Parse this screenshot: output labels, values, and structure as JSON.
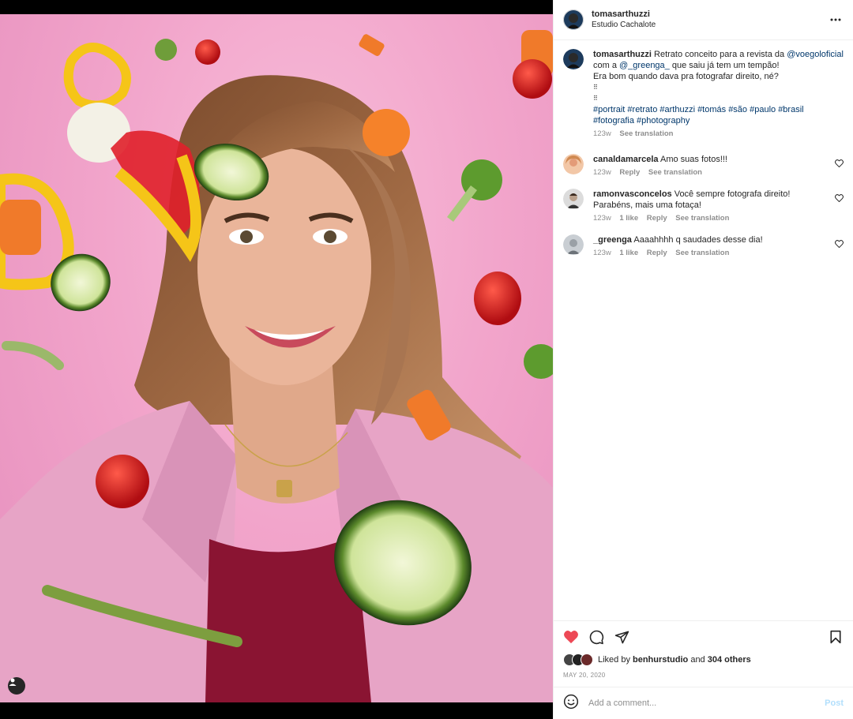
{
  "post": {
    "username": "tomasarthuzzi",
    "location": "Estudio Cachalote"
  },
  "caption": {
    "username": "tomasarthuzzi",
    "text_1": " Retrato conceito para a revista da ",
    "mention_1": "@voegoloficial",
    "text_2": " com a ",
    "mention_2": "@_greenga_",
    "text_3": " que saiu já tem um tempão!",
    "line_2": "Era bom quando dava pra fotografar direito, né?",
    "dots": [
      "⠿",
      "⠿"
    ],
    "hashtags_line_1": "#portrait #retrato #arthuzzi #tomás #são #paulo #brasil",
    "hashtags_line_2": "#fotografia #photography",
    "time": "123w",
    "see_translation": "See translation"
  },
  "comments": [
    {
      "username": "canaldamarcela",
      "text": " Amo suas fotos!!!",
      "time": "123w",
      "likes": "",
      "reply": "Reply",
      "translation": "See translation"
    },
    {
      "username": "ramonvasconcelos",
      "text": " Você sempre fotografa direito! Parabéns, mais uma fotaça!",
      "time": "123w",
      "likes": "1 like",
      "reply": "Reply",
      "translation": "See translation"
    },
    {
      "username": "_greenga",
      "text": " Aaaahhhh q saudades desse dia!",
      "time": "123w",
      "likes": "1 like",
      "reply": "Reply",
      "translation": "See translation"
    }
  ],
  "likes": {
    "prefix": "Liked by ",
    "user": "benhurstudio",
    "middle": " and ",
    "others": "304 others"
  },
  "date": "MAY 20, 2020",
  "comment_input": {
    "placeholder": "Add a comment..."
  },
  "post_button": "Post",
  "colors": {
    "like_red": "#ed4956",
    "link": "#00376b",
    "post_disabled": "#b2dffc",
    "meta_grey": "#8e8e8e"
  },
  "icons": [
    "more-options-icon",
    "heart-icon",
    "comment-icon",
    "share-icon",
    "bookmark-icon",
    "emoji-icon",
    "user-tag-icon"
  ]
}
